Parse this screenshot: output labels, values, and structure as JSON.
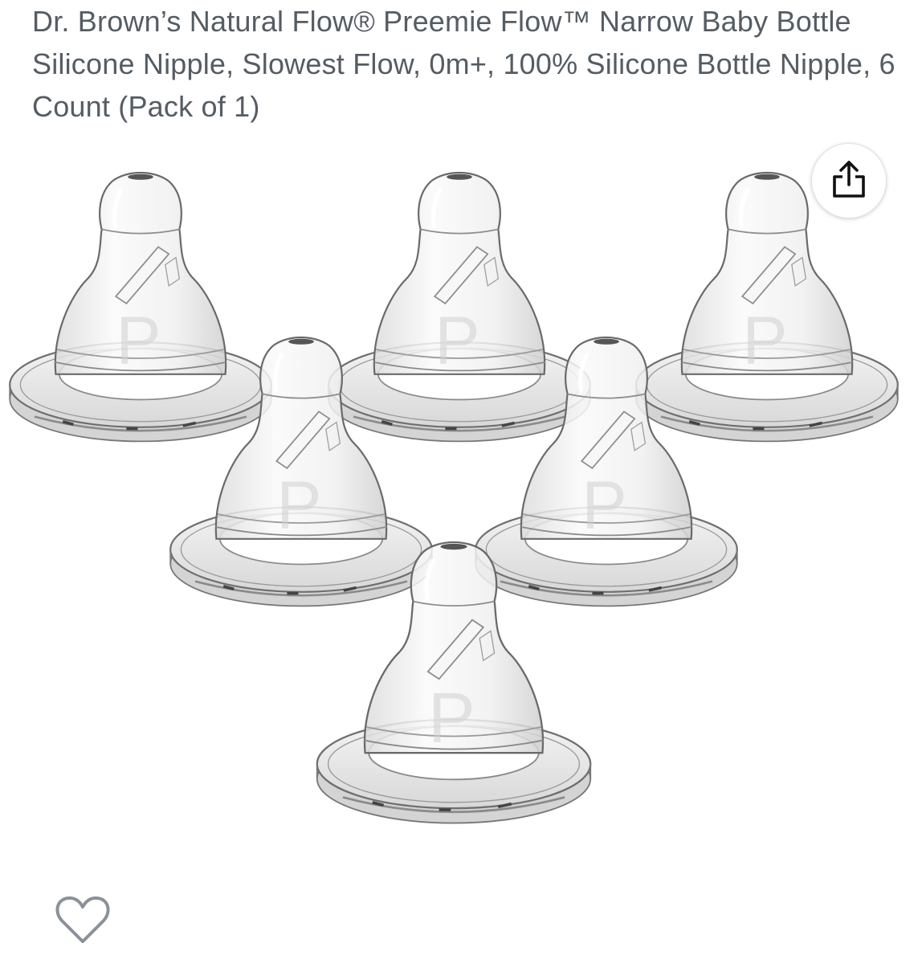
{
  "product": {
    "title": "Dr. Brown’s Natural Flow® Preemie Flow™ Narrow Baby Bottle Silicone Nipple, Slowest Flow, 0m+, 100% Silicone Bottle Nipple, 6 Count (Pack of 1)"
  },
  "gallery": {
    "nipple_count": 6,
    "nipple_mark": "P"
  },
  "icons": {
    "share": "share-icon",
    "wishlist": "heart-outline-icon"
  },
  "colors": {
    "title_text": "#555c63",
    "icon_stroke": "#111111",
    "heart_stroke": "#8a9199",
    "silicone_outline": "#6f6f6f"
  }
}
